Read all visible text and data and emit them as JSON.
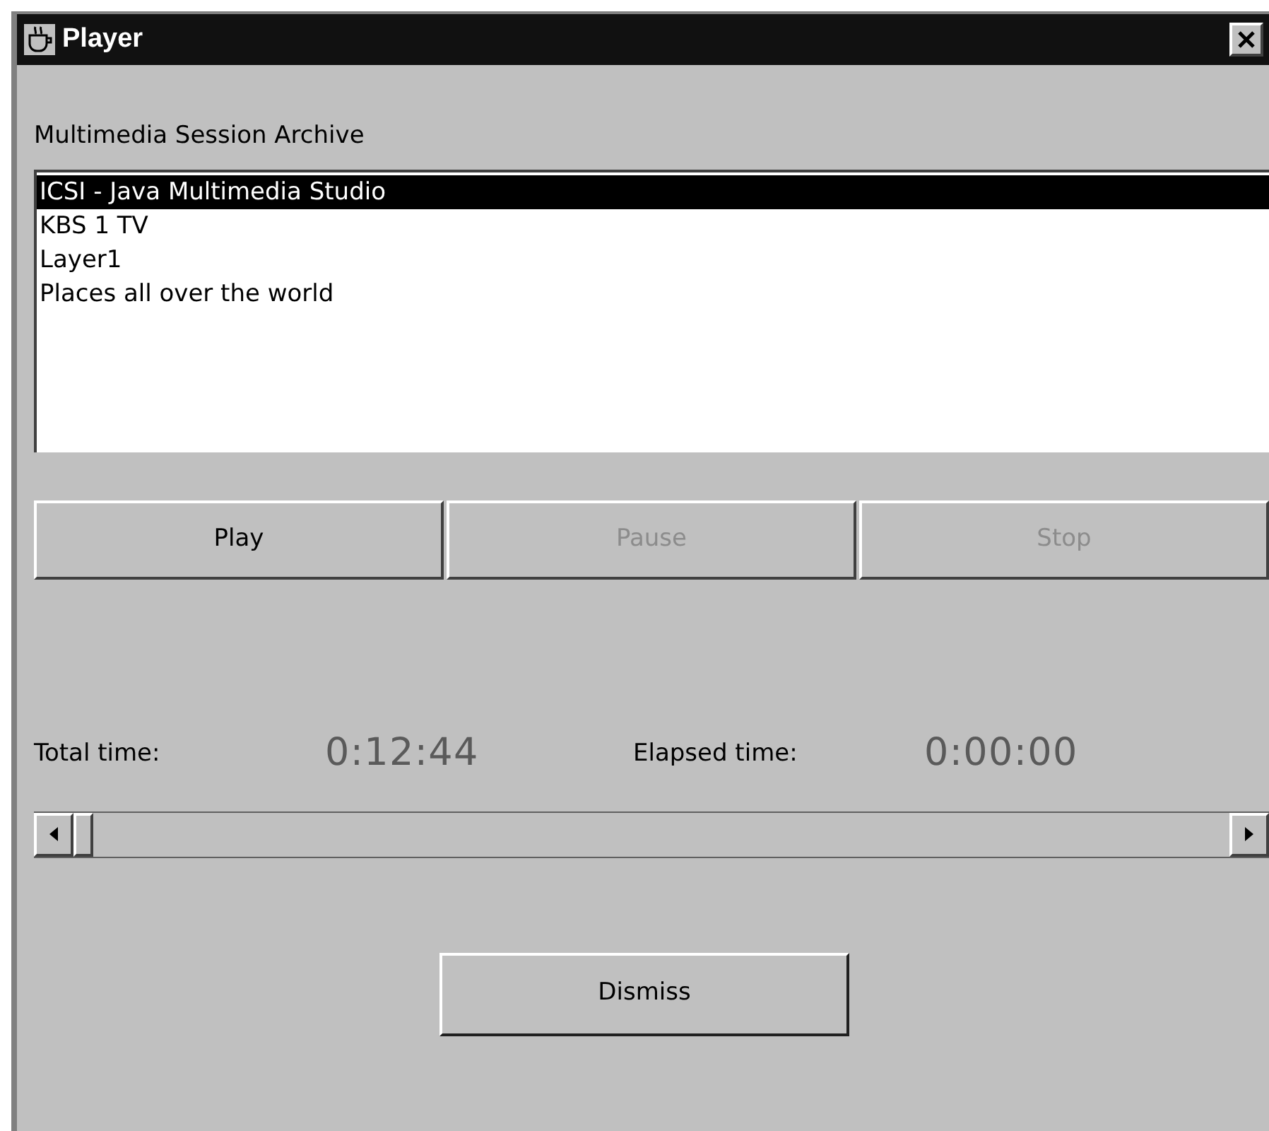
{
  "window": {
    "title": "Player"
  },
  "archive": {
    "label": "Multimedia Session Archive",
    "items": [
      {
        "label": "ICSI - Java Multimedia Studio",
        "selected": true
      },
      {
        "label": "KBS 1 TV",
        "selected": false
      },
      {
        "label": "Layer1",
        "selected": false
      },
      {
        "label": "Places all over the world",
        "selected": false
      }
    ]
  },
  "controls": [
    {
      "label": "Play",
      "disabled": false
    },
    {
      "label": "Pause",
      "disabled": true
    },
    {
      "label": "Stop",
      "disabled": true
    }
  ],
  "times": [
    {
      "label": "Total time:",
      "value": "0:12:44"
    },
    {
      "label": "Elapsed time:",
      "value": "0:00:00"
    }
  ],
  "position": {
    "level": 0
  },
  "dismiss": {
    "label": "Dismiss"
  }
}
